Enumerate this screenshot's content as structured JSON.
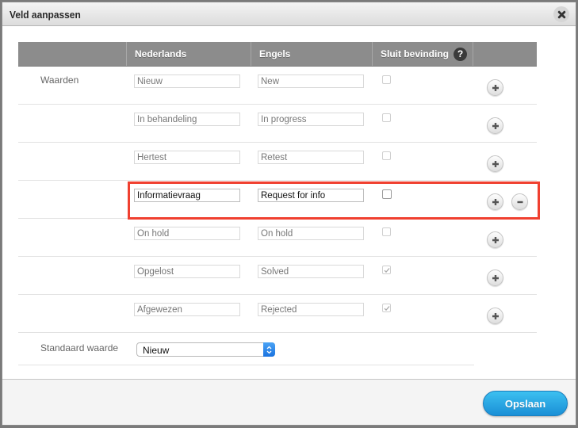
{
  "dialog": {
    "title": "Veld aanpassen",
    "close_icon": "close-icon"
  },
  "table": {
    "headers": [
      "",
      "Nederlands",
      "Engels",
      "Sluit bevinding",
      ""
    ],
    "help_icon": "?",
    "section_label": "Waarden",
    "rows": [
      {
        "nl": "Nieuw",
        "en": "New",
        "closes": false,
        "removable": false
      },
      {
        "nl": "In behandeling",
        "en": "In progress",
        "closes": false,
        "removable": false
      },
      {
        "nl": "Hertest",
        "en": "Retest",
        "closes": false,
        "removable": false
      },
      {
        "nl": "Informatievraag",
        "en": "Request for info",
        "closes": false,
        "removable": true,
        "active": true
      },
      {
        "nl": "On hold",
        "en": "On hold",
        "closes": false,
        "removable": false
      },
      {
        "nl": "Opgelost",
        "en": "Solved",
        "closes": true,
        "removable": false
      },
      {
        "nl": "Afgewezen",
        "en": "Rejected",
        "closes": true,
        "removable": false
      }
    ]
  },
  "default_value": {
    "label": "Standaard waarde",
    "selected": "Nieuw"
  },
  "footer": {
    "save_label": "Opslaan"
  },
  "colors": {
    "highlight": "#f04030",
    "save_button": "#1a8fd6",
    "header_bg": "#8c8c8c"
  }
}
